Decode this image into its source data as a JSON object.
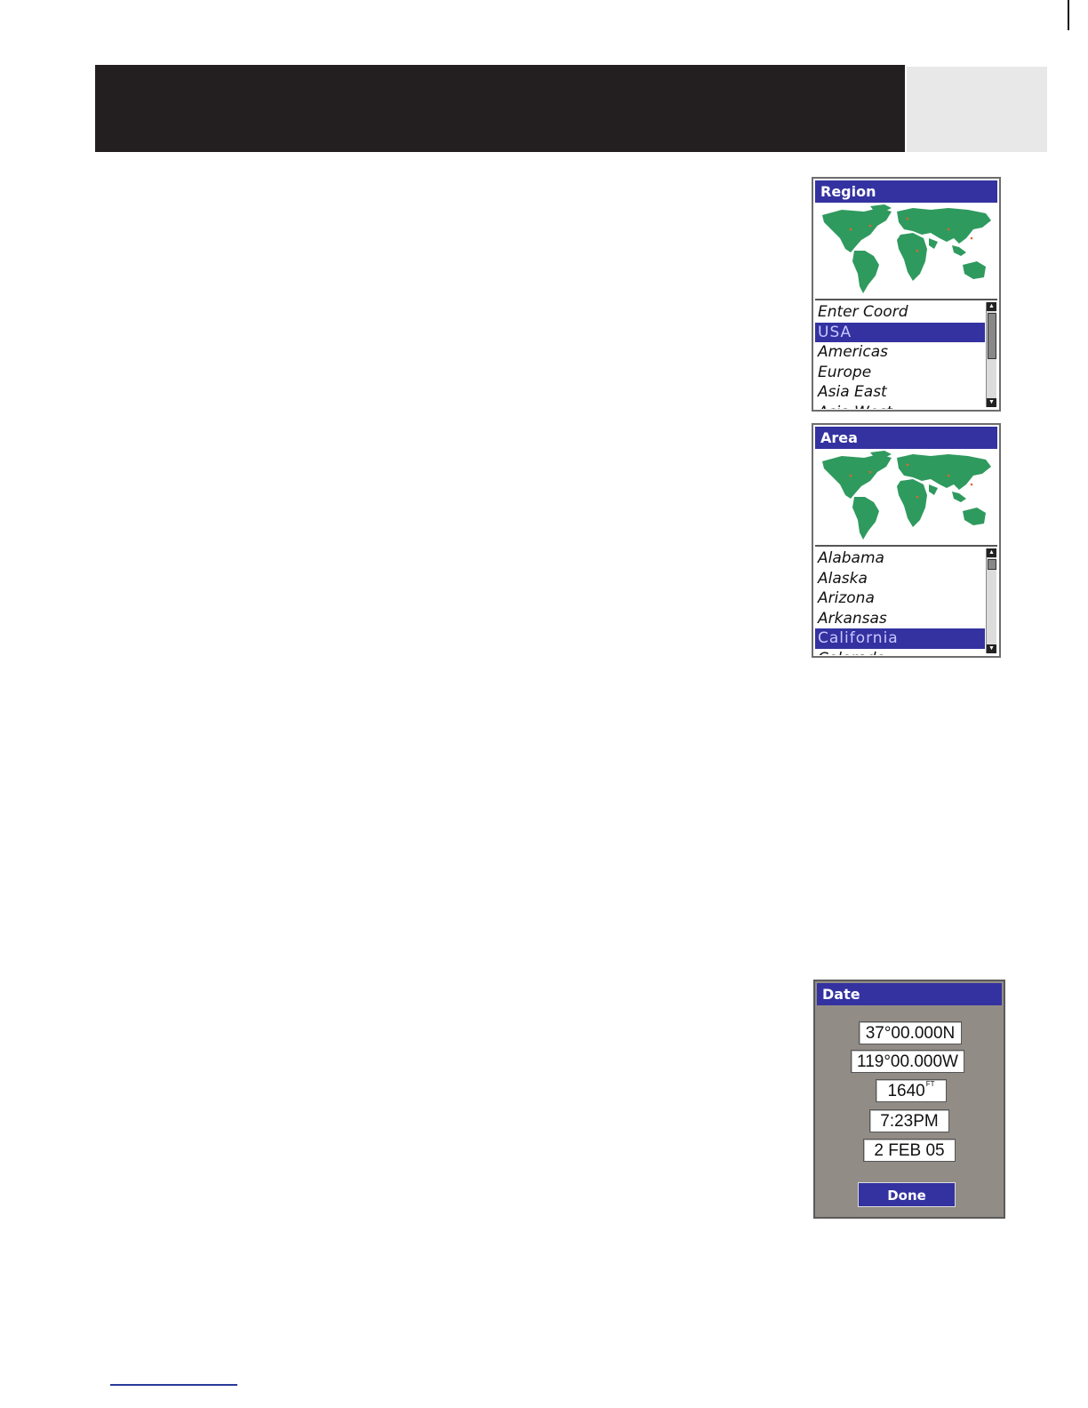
{
  "region_screen": {
    "title": "Region",
    "items": [
      "Enter Coord",
      "USA",
      "Americas",
      "Europe",
      "Asia East",
      "Asia West"
    ],
    "selected_index": 1
  },
  "area_screen": {
    "title": "Area",
    "items": [
      "Alabama",
      "Alaska",
      "Arizona",
      "Arkansas",
      "California",
      "Colorado"
    ],
    "selected_index": 4
  },
  "date_screen": {
    "title": "Date",
    "latitude": "37°00.000N",
    "longitude": "119°00.000W",
    "elevation": "1640",
    "elevation_unit": "FT",
    "time": "7:23PM",
    "date": "2 FEB 05",
    "done_label": "Done"
  },
  "colors": {
    "title_bar": "#3432a0",
    "map_land": "#2f9a5e",
    "header_bar": "#231f20"
  }
}
